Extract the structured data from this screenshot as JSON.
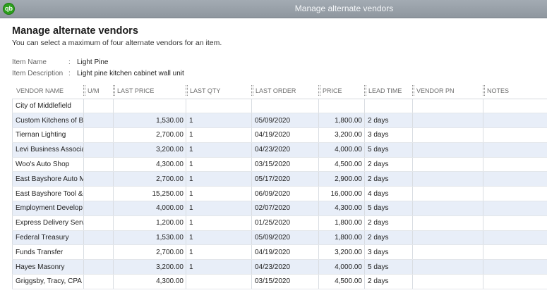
{
  "window": {
    "title": "Manage alternate vendors",
    "app_icon_label": "qb"
  },
  "heading": "Manage alternate vendors",
  "subheading": "You can select a maximum of four alternate vendors for an item.",
  "item": {
    "name_label": "Item Name",
    "name_value": "Light Pine",
    "desc_label": "Item Description",
    "desc_value": "Light pine kitchen cabinet wall unit",
    "colon": ":"
  },
  "columns": [
    "VENDOR NAME",
    "U/M",
    "LAST PRICE",
    "LAST QTY",
    "LAST ORDER",
    "PRICE",
    "LEAD TIME",
    "VENDOR PN",
    "NOTES"
  ],
  "rows": [
    {
      "vendor": "City of Middlefield",
      "um": "",
      "last_price": "",
      "last_qty": "",
      "last_order": "",
      "price": "",
      "lead_time": "",
      "vendor_pn": "",
      "notes": ""
    },
    {
      "vendor": "Custom Kitchens of Ba",
      "um": "",
      "last_price": "1,530.00",
      "last_qty": "1",
      "last_order": "05/09/2020",
      "price": "1,800.00",
      "lead_time": "2 days",
      "vendor_pn": "",
      "notes": ""
    },
    {
      "vendor": "Tiernan Lighting",
      "um": "",
      "last_price": "2,700.00",
      "last_qty": "1",
      "last_order": "04/19/2020",
      "price": "3,200.00",
      "lead_time": "3 days",
      "vendor_pn": "",
      "notes": ""
    },
    {
      "vendor": "Levi Business Associa",
      "um": "",
      "last_price": "3,200.00",
      "last_qty": "1",
      "last_order": "04/23/2020",
      "price": "4,000.00",
      "lead_time": "5 days",
      "vendor_pn": "",
      "notes": ""
    },
    {
      "vendor": "Woo's Auto Shop",
      "um": "",
      "last_price": "4,300.00",
      "last_qty": "1",
      "last_order": "03/15/2020",
      "price": "4,500.00",
      "lead_time": "2 days",
      "vendor_pn": "",
      "notes": ""
    },
    {
      "vendor": "East Bayshore Auto Ma",
      "um": "",
      "last_price": "2,700.00",
      "last_qty": "1",
      "last_order": "05/17/2020",
      "price": "2,900.00",
      "lead_time": "2 days",
      "vendor_pn": "",
      "notes": ""
    },
    {
      "vendor": "East Bayshore Tool & S",
      "um": "",
      "last_price": "15,250.00",
      "last_qty": "1",
      "last_order": "06/09/2020",
      "price": "16,000.00",
      "lead_time": "4 days",
      "vendor_pn": "",
      "notes": ""
    },
    {
      "vendor": "Employment Develop",
      "um": "",
      "last_price": "4,000.00",
      "last_qty": "1",
      "last_order": "02/07/2020",
      "price": "4,300.00",
      "lead_time": "5 days",
      "vendor_pn": "",
      "notes": ""
    },
    {
      "vendor": "Express Delivery Servic",
      "um": "",
      "last_price": "1,200.00",
      "last_qty": "1",
      "last_order": "01/25/2020",
      "price": "1,800.00",
      "lead_time": "2 days",
      "vendor_pn": "",
      "notes": ""
    },
    {
      "vendor": "Federal Treasury",
      "um": "",
      "last_price": "1,530.00",
      "last_qty": "1",
      "last_order": "05/09/2020",
      "price": "1,800.00",
      "lead_time": "2 days",
      "vendor_pn": "",
      "notes": ""
    },
    {
      "vendor": "Funds Transfer",
      "um": "",
      "last_price": "2,700.00",
      "last_qty": "1",
      "last_order": "04/19/2020",
      "price": "3,200.00",
      "lead_time": "3 days",
      "vendor_pn": "",
      "notes": ""
    },
    {
      "vendor": "Hayes Masonry",
      "um": "",
      "last_price": "3,200.00",
      "last_qty": "1",
      "last_order": "04/23/2020",
      "price": "4,000.00",
      "lead_time": "5 days",
      "vendor_pn": "",
      "notes": ""
    },
    {
      "vendor": "Griggsby, Tracy, CPA",
      "um": "",
      "last_price": "4,300.00",
      "last_qty": "",
      "last_order": "03/15/2020",
      "price": "4,500.00",
      "lead_time": "2 days",
      "vendor_pn": "",
      "notes": ""
    }
  ],
  "colors": {
    "titlebar": "#979fa7",
    "row_alt": "#e8eef8",
    "brand": "#2ca01c"
  }
}
